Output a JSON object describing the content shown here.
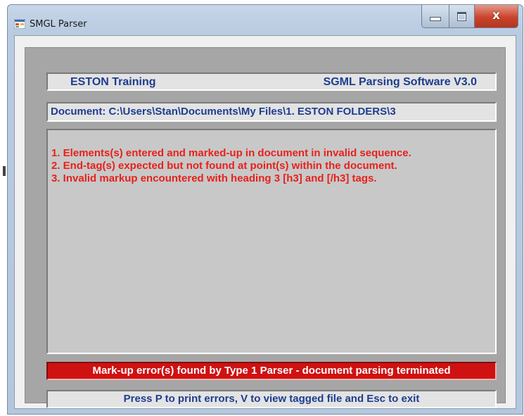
{
  "window": {
    "title": "SMGL Parser",
    "icon": "app-window-icon",
    "controls": {
      "minimize_icon": "minimize-icon",
      "maximize_icon": "maximize-icon",
      "close_icon": "close-icon",
      "close_glyph": "x"
    }
  },
  "header": {
    "left": "ESTON Training",
    "right": "SGML Parsing Software V3.0"
  },
  "document": {
    "path_text": "Document: C:\\Users\\Stan\\Documents\\My Files\\1. ESTON FOLDERS\\3"
  },
  "errors": [
    "1. Elements(s) entered and marked-up in document in invalid sequence.",
    "2. End-tag(s) expected but not found at point(s) within the document.",
    "3. Invalid markup encountered with heading 3 [h3] and [/h3] tags."
  ],
  "status": {
    "message": "Mark-up error(s) found by Type 1 Parser - document parsing terminated",
    "color": "#cf1111"
  },
  "instructions": {
    "text": "Press P to print errors, V to view tagged file and Esc to exit"
  },
  "colors": {
    "header_text": "#1d3d8f",
    "error_text": "#e8211b",
    "panel_bg": "#a6a6a6"
  }
}
